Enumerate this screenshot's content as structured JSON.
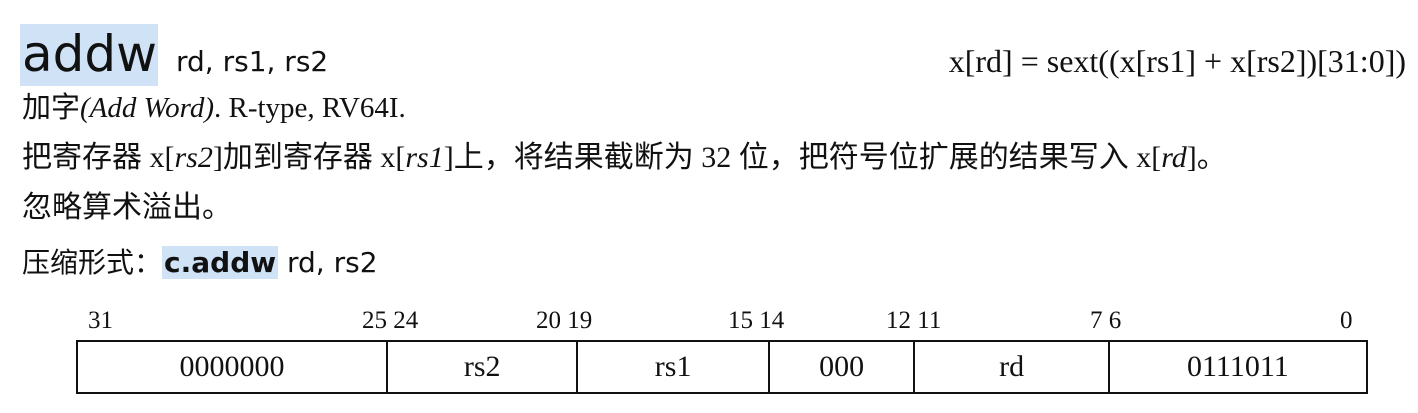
{
  "instruction": {
    "mnemonic": "addw",
    "operands": "rd, rs1, rs2",
    "formula": "x[rd] = sext((x[rs1] + x[rs2])[31:0])"
  },
  "type_line": {
    "name_cn": "加字",
    "name_en": "(Add Word)",
    "format": ". R-type, RV64I."
  },
  "description": {
    "parts": [
      "把寄存器 x[",
      "rs2",
      "]加到寄存器 x[",
      "rs1",
      "]上，将结果截断为 32 位，把符号位扩展的结果写入 x[",
      "rd",
      "]。"
    ],
    "line2": "忽略算术溢出。"
  },
  "compressed": {
    "label": "压缩形式：",
    "name": "c.addw",
    "operands": " rd, rs2"
  },
  "encoding": {
    "bit_labels": [
      "31",
      "25 24",
      "20 19",
      "15 14",
      "12 11",
      "7 6",
      "0"
    ],
    "fields": [
      "0000000",
      "rs2",
      "rs1",
      "000",
      "rd",
      "0111011"
    ]
  }
}
